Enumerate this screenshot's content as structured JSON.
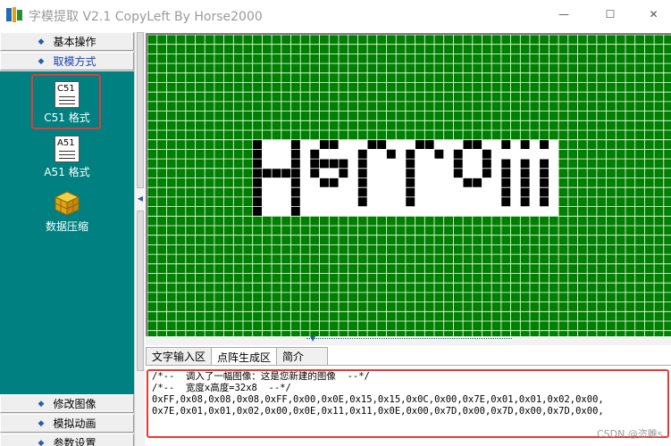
{
  "window": {
    "title": "字模提取 V2.1  CopyLeft By Horse2000",
    "min_glyph": "—",
    "max_glyph": "☐",
    "close_glyph": "✕"
  },
  "sidebar": {
    "top_items": [
      {
        "label": "基本操作",
        "icon": "diamond-icon"
      },
      {
        "label": "取模方式",
        "icon": "diamond-icon"
      }
    ],
    "tools": [
      {
        "label": "C51 格式",
        "icon_text": "C51",
        "icon": "c51-document-icon"
      },
      {
        "label": "A51 格式",
        "icon_text": "A51",
        "icon": "a51-document-icon"
      },
      {
        "label": "数据压缩",
        "icon": "compress-cube-icon"
      }
    ],
    "bottom_items": [
      {
        "label": "修改图像",
        "icon": "diamond-icon"
      },
      {
        "label": "模拟动画",
        "icon": "diamond-icon"
      },
      {
        "label": "参数设置",
        "icon": "diamond-icon"
      }
    ]
  },
  "tabs": [
    {
      "label": "文字输入区",
      "active": false
    },
    {
      "label": "点阵生成区",
      "active": true
    },
    {
      "label": "简介",
      "active": false
    }
  ],
  "output": {
    "lines": [
      "/*--  调入了一幅图像：这是您新建的图像  --*/",
      "/*--  宽度x高度=32x8  --*/",
      "0xFF,0x08,0x08,0x08,0xFF,0x00,0x0E,0x15,0x15,0x0C,0x00,0x7E,0x01,0x01,0x02,0x00,",
      "0x7E,0x01,0x01,0x02,0x00,0x0E,0x11,0x11,0x0E,0x00,0x7D,0x00,0x7D,0x00,0x7D,0x00,"
    ]
  },
  "colors": {
    "grid_green": "#008000",
    "grid_line": "#ffffff",
    "canvas_white": "#ffffff",
    "pixel_on": "#000000",
    "sidebar_teal": "#008080",
    "highlight_red": "#e53935"
  },
  "watermark": "CSDN @恣睢s"
}
